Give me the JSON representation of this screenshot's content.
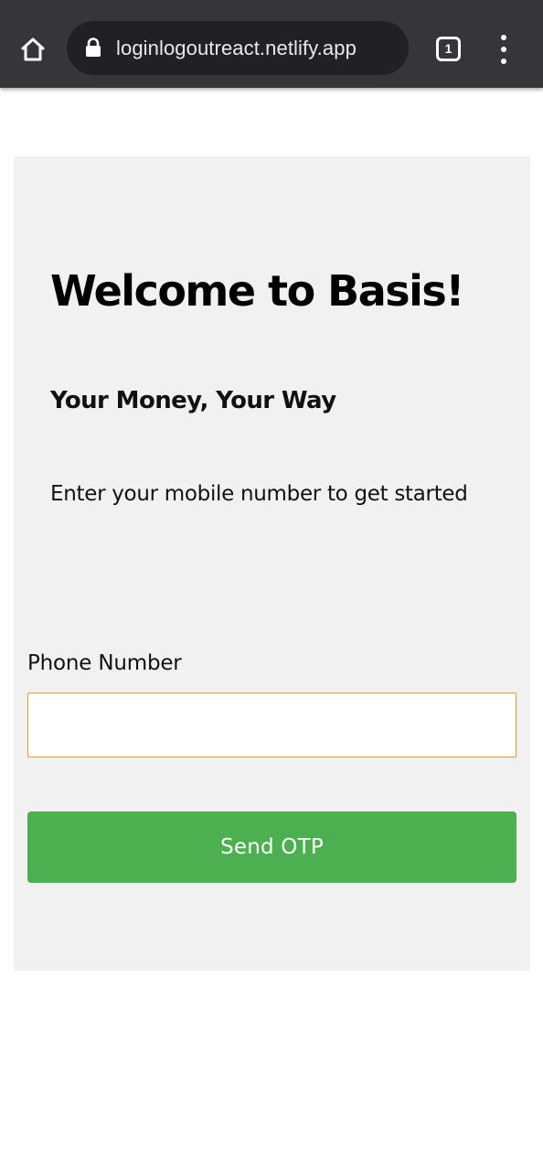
{
  "browser": {
    "url": "loginlogoutreact.netlify.app",
    "tab_count": "1",
    "icons": {
      "home": "home-icon",
      "lock": "lock-icon",
      "tabs": "tab-switcher-icon",
      "menu": "more-vert-icon"
    },
    "toolbar_color": "#35363a",
    "omnibox_color": "#202124"
  },
  "login": {
    "title": "Welcome to Basis!",
    "tagline": "Your Money, Your Way",
    "instruction": "Enter your mobile number to get started",
    "phone_label": "Phone Number",
    "phone_value": "",
    "send_button_label": "Send OTP",
    "card_color": "#f1f1f1",
    "button_color": "#4caf50",
    "input_border_color": "#e09a2a"
  }
}
